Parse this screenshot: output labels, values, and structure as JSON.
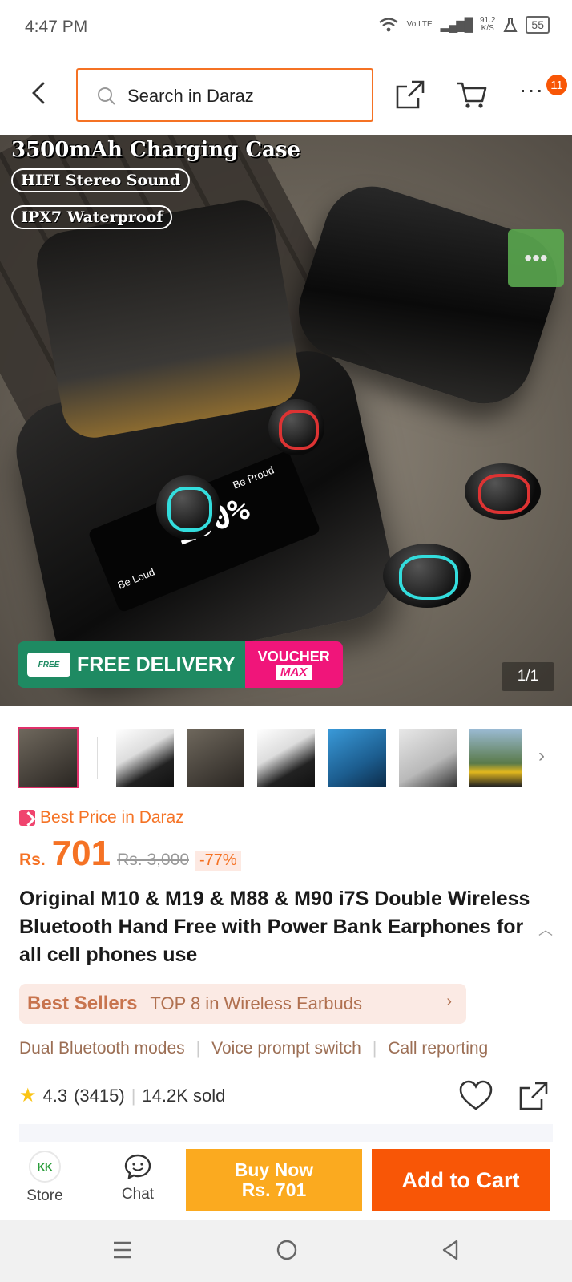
{
  "status_bar": {
    "time": "4:47 PM",
    "network_label": "Vo LTE",
    "speed_value": "91.2",
    "speed_unit": "K/S",
    "battery": "55"
  },
  "header": {
    "search_placeholder": "Search in Daraz",
    "cart_badge": "11"
  },
  "hero": {
    "headline": "3500mAh Charging Case",
    "feature_1": "HIFI Stereo Sound",
    "feature_2": "IPX7 Waterproof",
    "lcd_left": "Be Loud",
    "lcd_percent": "100%",
    "lcd_right": "Be Proud",
    "free_badge": "FREE",
    "free_delivery": "FREE DELIVERY",
    "voucher": "VOUCHER",
    "voucher_max": "MAX",
    "counter": "1/1"
  },
  "thumbnails": {
    "count": 7
  },
  "product": {
    "best_price_label": "Best Price in Daraz",
    "currency": "Rs.",
    "price": "701",
    "original_price": "Rs. 3,000",
    "discount": "-77%",
    "title": "Original M10 & M19 & M88 & M90 i7S Double Wireless Bluetooth Hand Free with Power Bank Earphones for all cell phones use",
    "best_sellers_label": "Best Sellers",
    "best_sellers_rank": "TOP 8 in Wireless Earbuds",
    "features": [
      "Dual Bluetooth modes",
      "Voice prompt switch",
      "Call reporting"
    ],
    "rating": "4.3",
    "rating_count": "(3415)",
    "sold": "14.2K sold"
  },
  "bottom_bar": {
    "store_label": "Store",
    "store_logo_text": "KK",
    "chat_label": "Chat",
    "buy_now_label": "Buy Now",
    "buy_now_price": "Rs. 701",
    "add_to_cart_label": "Add to Cart"
  },
  "colors": {
    "brand": "#f57224",
    "add_to_cart": "#f85606",
    "buy_now": "#fbaa1f",
    "free_delivery": "#1e8a62",
    "voucher": "#f0157a"
  }
}
